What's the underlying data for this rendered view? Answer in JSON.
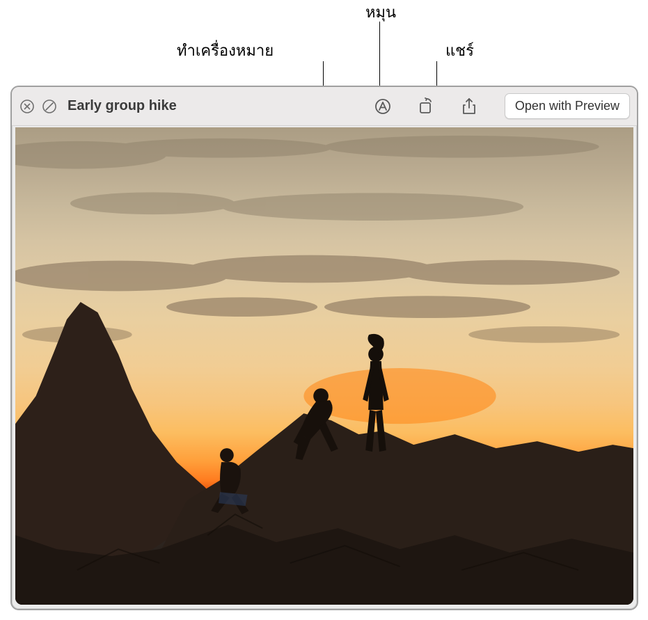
{
  "callouts": {
    "markup": "ทำเครื่องหมาย",
    "rotate": "หมุน",
    "share": "แชร์"
  },
  "titlebar": {
    "title": "Early group hike",
    "open_button": "Open with Preview"
  },
  "icons": {
    "close": "close-icon",
    "skip": "skip-icon",
    "markup": "markup-icon",
    "rotate": "rotate-icon",
    "share": "share-icon"
  }
}
